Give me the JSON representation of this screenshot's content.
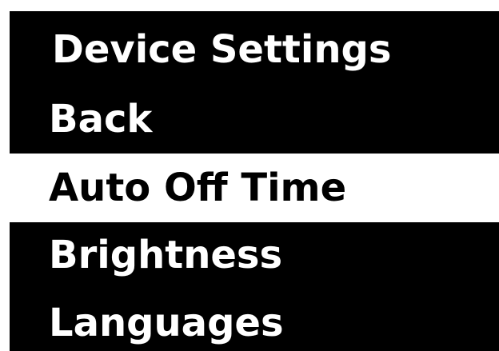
{
  "screen": {
    "title": "Device Settings",
    "colors": {
      "background": "#000000",
      "text": "#ffffff",
      "selected_background": "#ffffff",
      "selected_text": "#000000"
    }
  },
  "menu": {
    "selected_index": 1,
    "items": [
      {
        "label": "Back"
      },
      {
        "label": "Auto Off Time"
      },
      {
        "label": "Brightness"
      },
      {
        "label": "Languages"
      }
    ]
  }
}
